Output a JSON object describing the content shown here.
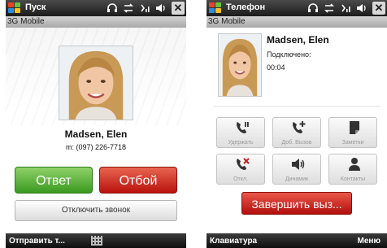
{
  "left_screen": {
    "title": "Пуск",
    "carrier": "3G Mobile",
    "caller_name": "Madsen, Elen",
    "caller_number": "m: (097) 226-7718",
    "answer_label": "Ответ",
    "reject_label": "Отбой",
    "mute_ringer_label": "Отключить звонок",
    "softkey_left": "Отправить т..."
  },
  "right_screen": {
    "title": "Телефон",
    "carrier": "3G Mobile",
    "caller_name": "Madsen, Elen",
    "call_status": "Подключено:",
    "call_timer": "00:04",
    "buttons": [
      {
        "label": "Удержать",
        "icon": "phone-hold-icon"
      },
      {
        "label": "Доб. Вызов",
        "icon": "add-call-icon"
      },
      {
        "label": "Заметки",
        "icon": "notes-icon"
      },
      {
        "label": "Откл.",
        "icon": "mute-mic-icon"
      },
      {
        "label": "Динамик",
        "icon": "speaker-icon"
      },
      {
        "label": "Контакты",
        "icon": "contacts-icon"
      }
    ],
    "end_call_label": "Завершить выз...",
    "softkey_left": "Клавиатура",
    "softkey_right": "Меню"
  },
  "colors": {
    "answer_green": "#4aa52a",
    "reject_red": "#c8201a",
    "titlebar_dark": "#2a2a2a"
  }
}
